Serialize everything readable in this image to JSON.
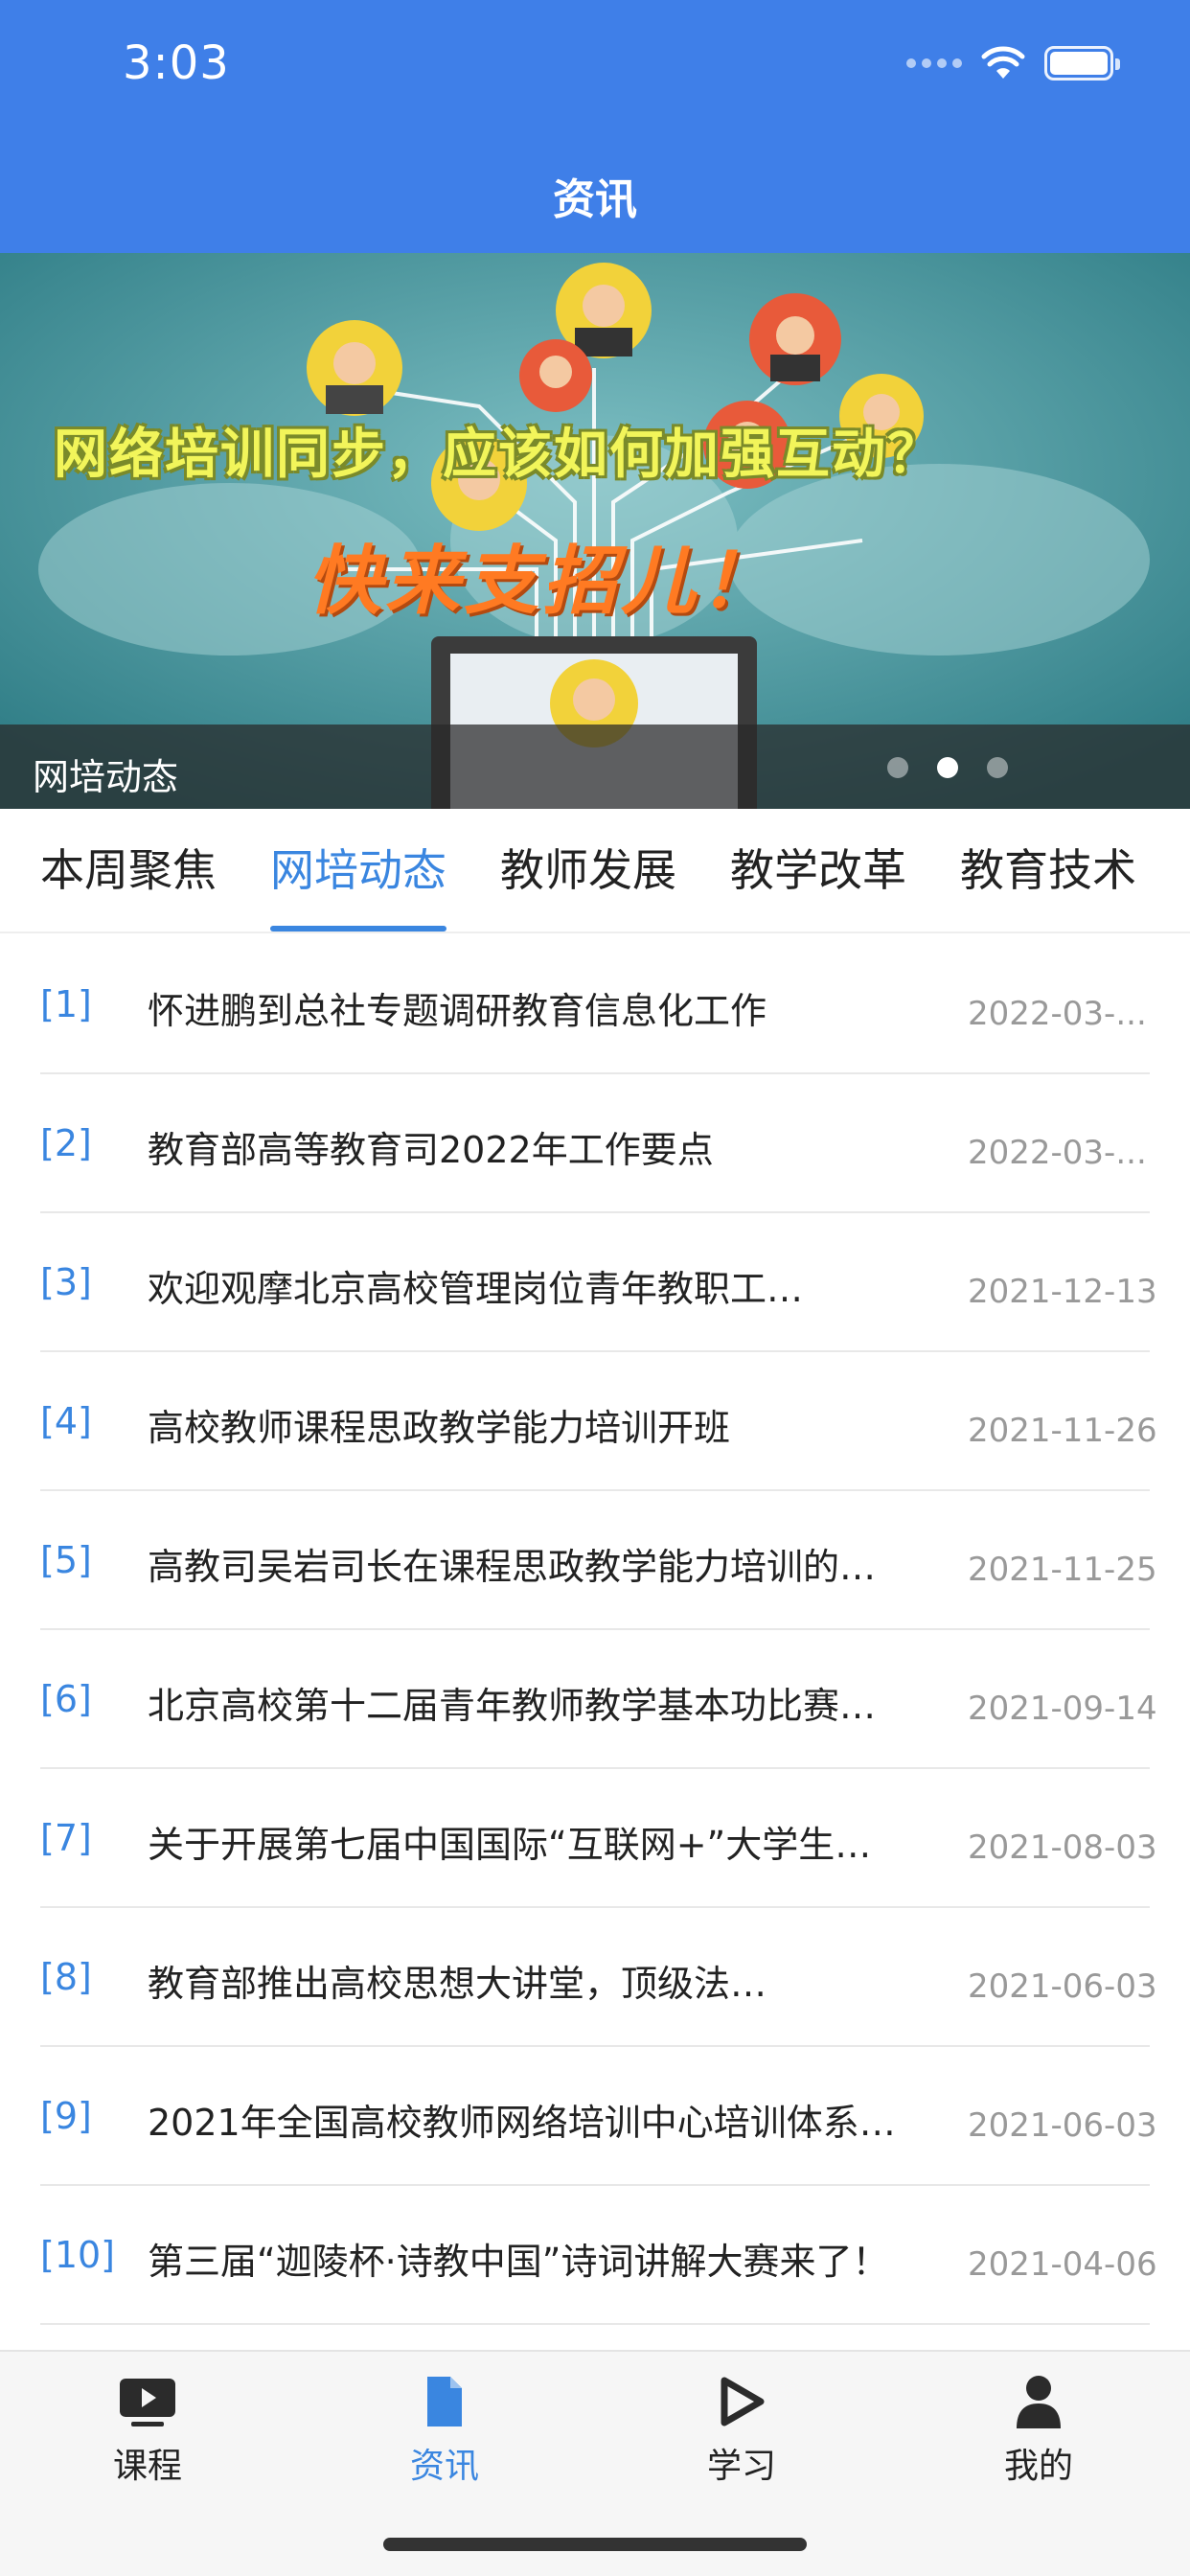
{
  "status_bar": {
    "time": "3:03"
  },
  "header": {
    "title": "资讯"
  },
  "banner": {
    "headline": "网络培训同步，应该如何加强互动？",
    "slogan": "快来支招儿！",
    "caption": "网培动态",
    "dots": 3,
    "active_dot": 1
  },
  "tabs": [
    {
      "label": "本周聚焦",
      "active": false
    },
    {
      "label": "网培动态",
      "active": true
    },
    {
      "label": "教师发展",
      "active": false
    },
    {
      "label": "教学改革",
      "active": false
    },
    {
      "label": "教育技术",
      "active": false
    }
  ],
  "news": [
    {
      "index": "[1]",
      "title": "怀进鹏到总社专题调研教育信息化工作",
      "date": "2022-03-..."
    },
    {
      "index": "[2]",
      "title": "教育部高等教育司2022年工作要点",
      "date": "2022-03-..."
    },
    {
      "index": "[3]",
      "title": "欢迎观摩北京高校管理岗位青年教职工…",
      "date": "2021-12-13"
    },
    {
      "index": "[4]",
      "title": "高校教师课程思政教学能力培训开班",
      "date": "2021-11-26"
    },
    {
      "index": "[5]",
      "title": "高教司吴岩司长在课程思政教学能力培训的…",
      "date": "2021-11-25"
    },
    {
      "index": "[6]",
      "title": "北京高校第十二届青年教师教学基本功比赛…",
      "date": "2021-09-14"
    },
    {
      "index": "[7]",
      "title": "关于开展第七届中国国际“互联网+”大学生…",
      "date": "2021-08-03"
    },
    {
      "index": "[8]",
      "title": "教育部推出高校思想大讲堂，顶级法…",
      "date": "2021-06-03"
    },
    {
      "index": "[9]",
      "title": "2021年全国高校教师网络培训中心培训体系…",
      "date": "2021-06-03"
    },
    {
      "index": "[10]",
      "title": "第三届“迦陵杯·诗教中国”诗词讲解大赛来了！",
      "date": "2021-04-06"
    }
  ],
  "bottom_nav": [
    {
      "label": "课程",
      "icon": "video-play-icon",
      "active": false
    },
    {
      "label": "资讯",
      "icon": "document-icon",
      "active": true
    },
    {
      "label": "学习",
      "icon": "play-circle-icon",
      "active": false
    },
    {
      "label": "我的",
      "icon": "person-icon",
      "active": false
    }
  ],
  "colors": {
    "brand": "#3f7fe8",
    "accent": "#3a86e0",
    "date": "#999999"
  }
}
